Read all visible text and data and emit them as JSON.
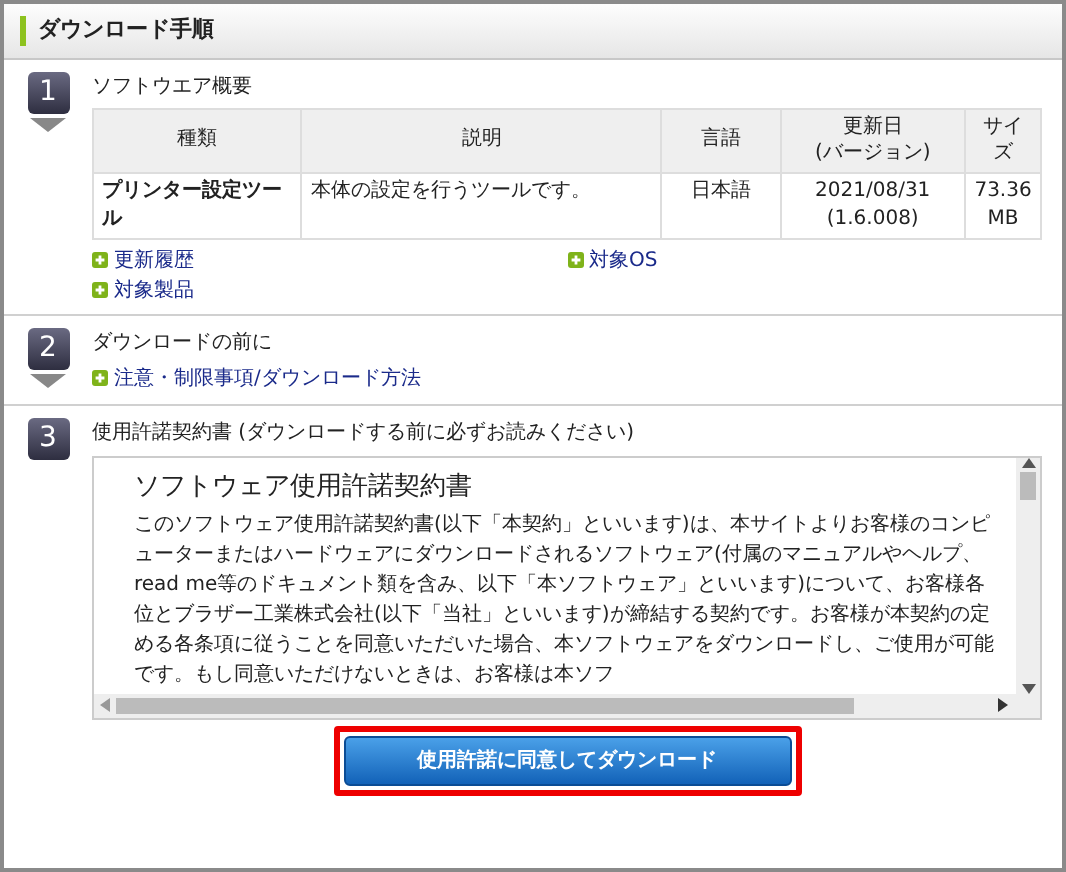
{
  "header": {
    "title": "ダウンロード手順"
  },
  "steps": [
    {
      "number": "1",
      "title": "ソフトウエア概要",
      "arrow": true,
      "table": {
        "columns": [
          "種類",
          "説明",
          "言語",
          "更新日\n(バージョン)",
          "サイズ"
        ],
        "rows": [
          [
            "プリンター設定ツール",
            "本体の設定を行うツールです。",
            "日本語",
            "2021/08/31\n(1.6.008)",
            "73.36\nMB"
          ]
        ]
      },
      "links": [
        {
          "label": "更新履歴"
        },
        {
          "label": "対象OS"
        },
        {
          "label": "対象製品"
        }
      ]
    },
    {
      "number": "2",
      "title": "ダウンロードの前に",
      "arrow": true,
      "links": [
        {
          "label": "注意・制限事項/ダウンロード方法"
        }
      ]
    },
    {
      "number": "3",
      "title": "使用許諾契約書 (ダウンロードする前に必ずお読みください)",
      "arrow": false,
      "license": {
        "title": "ソフトウェア使用許諾契約書",
        "text": "このソフトウェア使用許諾契約書(以下「本契約」といいます)は、本サイトよりお客様のコンピューターまたはハードウェアにダウンロードされるソフトウェア(付属のマニュアルやヘルプ、read me等のドキュメント類を含み、以下「本ソフトウェア」といいます)について、お客様各位とブラザー工業株式会社(以下「当社」といいます)が締結する契約です。お客様が本契約の定める各条項に従うことを同意いただいた場合、本ソフトウェアをダウンロードし、ご使用が可能です。もし同意いただけないときは、お客様は本ソフ"
      }
    }
  ],
  "button": {
    "label": "使用許諾に同意してダウンロード",
    "highlighted": true
  }
}
